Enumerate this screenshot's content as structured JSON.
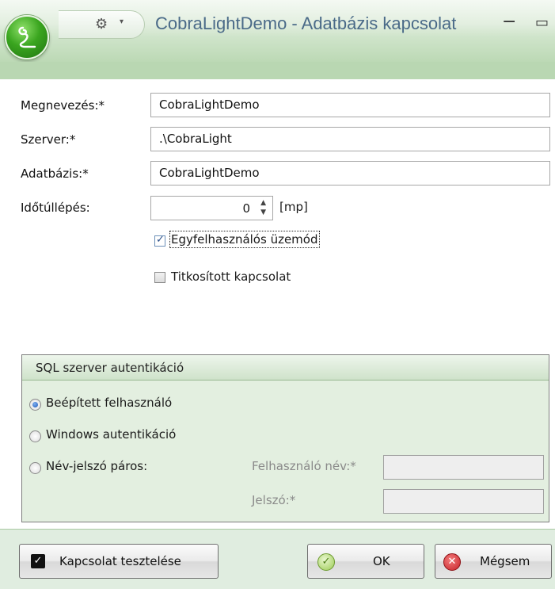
{
  "window": {
    "title": "CobraLightDemo - Adatbázis kapcsolat",
    "minimize_glyph": "−",
    "restore_glyph": "▭",
    "quick_access_icon": "gear-icon",
    "quick_access_arrow": "▾",
    "orb_icon": "cobra-logo-icon"
  },
  "form": {
    "name_label": "Megnevezés:*",
    "name_value": "CobraLightDemo",
    "server_label": "Szerver:*",
    "server_value": ".\\CobraLight",
    "database_label": "Adatbázis:*",
    "database_value": "CobraLightDemo",
    "timeout_label": "Időtúllépés:",
    "timeout_value": "0",
    "timeout_unit": "[mp]",
    "single_user_label": "Egyfelhasználós üzemód",
    "single_user_checked": true,
    "encrypted_label": "Titkosított kapcsolat",
    "encrypted_checked": false
  },
  "auth": {
    "group_title": "SQL szerver autentikáció",
    "options": [
      {
        "label": "Beépített felhasználó",
        "selected": true
      },
      {
        "label": "Windows autentikáció",
        "selected": false
      },
      {
        "label": "Név-jelszó páros:",
        "selected": false
      }
    ],
    "username_label": "Felhasználó név:*",
    "username_value": "",
    "password_label": "Jelszó:*",
    "password_value": ""
  },
  "buttons": {
    "test_label": "Kapcsolat tesztelése",
    "ok_label": "OK",
    "cancel_label": "Mégsem"
  },
  "colors": {
    "title_text": "#4a6a88",
    "accent_green": "#3aa51f",
    "panel_green": "#e3efe0",
    "cancel_red": "#d6343a"
  }
}
